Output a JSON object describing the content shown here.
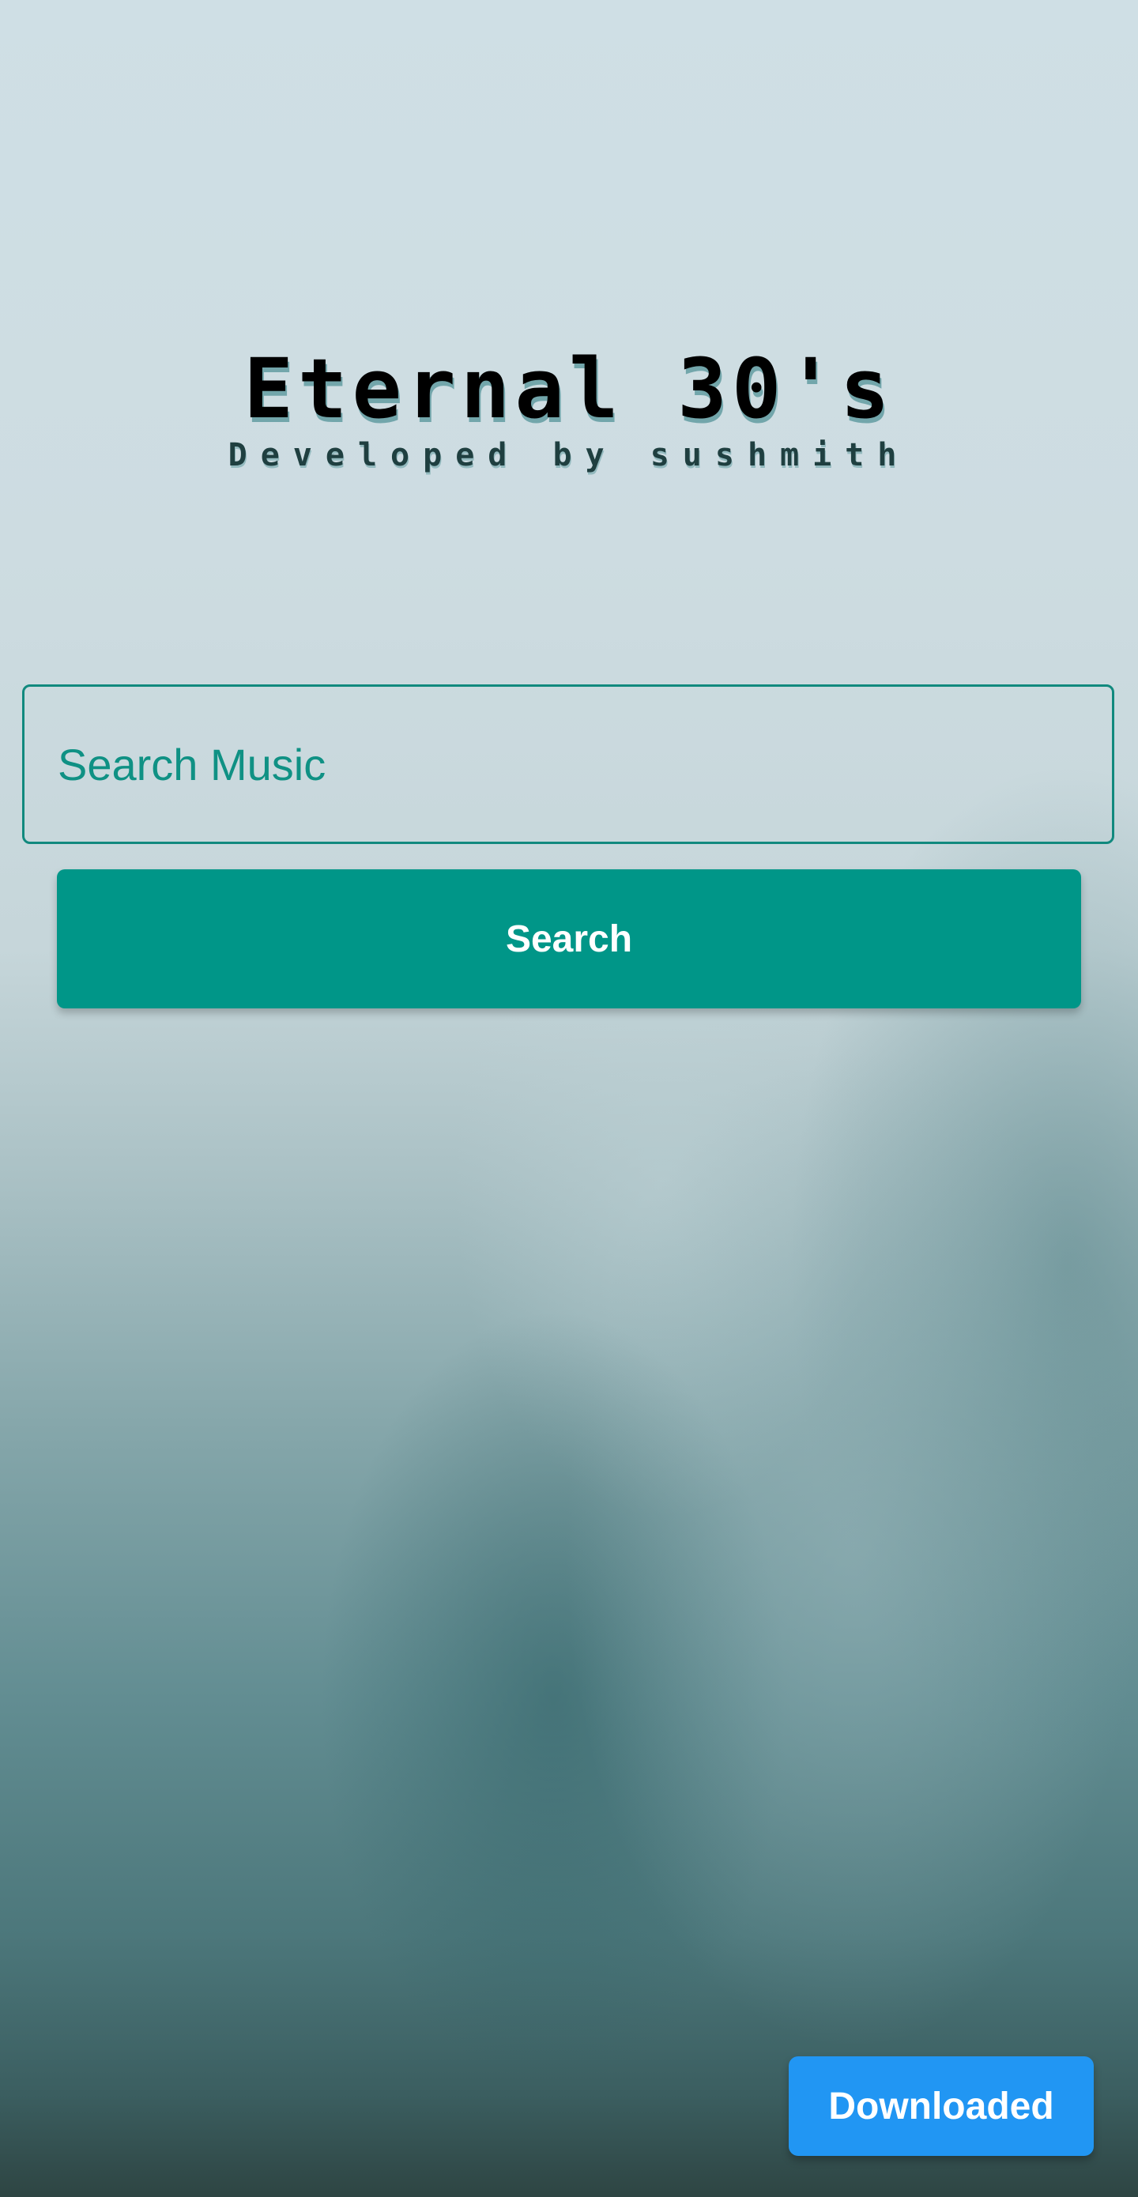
{
  "header": {
    "title": "Eternal 30's",
    "subtitle": "Developed by sushmith"
  },
  "search": {
    "placeholder": "Search Music",
    "value": "",
    "button_label": "Search"
  },
  "footer": {
    "downloaded_label": "Downloaded"
  },
  "colors": {
    "accent": "#009688",
    "secondary_button": "#2196f3",
    "title_text": "#000000"
  }
}
